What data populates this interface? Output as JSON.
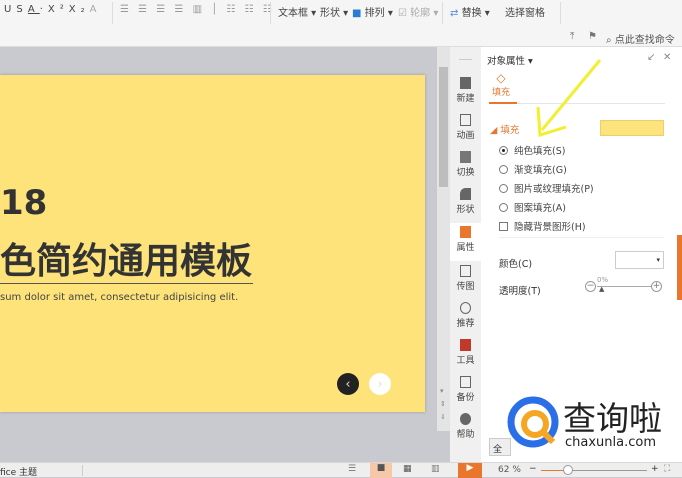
{
  "toolbar": {
    "format_btns": [
      "U",
      "S",
      "A",
      "·",
      "X²",
      "X₂",
      "A"
    ],
    "textbox": "文本框",
    "shape": "形状",
    "arrange": "排列",
    "outline": "轮廓",
    "replace": "替换",
    "select_pane": "选择窗格",
    "search": "点此查找命令"
  },
  "slide": {
    "year": "18",
    "title": "色简约通用模板",
    "subtitle": "sum dolor sit amet, consectetur adipisicing elit.",
    "prev": "‹",
    "next": "›"
  },
  "side_tabs": [
    {
      "label": "新建"
    },
    {
      "label": "动画"
    },
    {
      "label": "切换"
    },
    {
      "label": "形状"
    },
    {
      "label": "属性"
    },
    {
      "label": "传图"
    },
    {
      "label": "推荐"
    },
    {
      "label": "工具"
    },
    {
      "label": "备份"
    },
    {
      "label": "帮助"
    }
  ],
  "panel": {
    "title": "对象属性",
    "tab": "填充",
    "section": "填充",
    "fill_color": "#fde37a",
    "options": [
      {
        "label": "纯色填充(S)",
        "checked": true
      },
      {
        "label": "渐变填充(G)",
        "checked": false
      },
      {
        "label": "图片或纹理填充(P)",
        "checked": false
      },
      {
        "label": "图案填充(A)",
        "checked": false
      }
    ],
    "hide_bg": "隐藏背景图形(H)",
    "color_label": "颜色(C)",
    "transparency_label": "透明度(T)",
    "transparency_value": "0%",
    "apply_all": "全"
  },
  "status": {
    "theme": "fice 主题",
    "zoom": "62 %",
    "zoom_fraction": 0.45
  },
  "watermark": {
    "brand": "查询啦",
    "domain": "chaxunla.com"
  },
  "colors": {
    "accent": "#e8762d",
    "slide": "#fde37a"
  }
}
